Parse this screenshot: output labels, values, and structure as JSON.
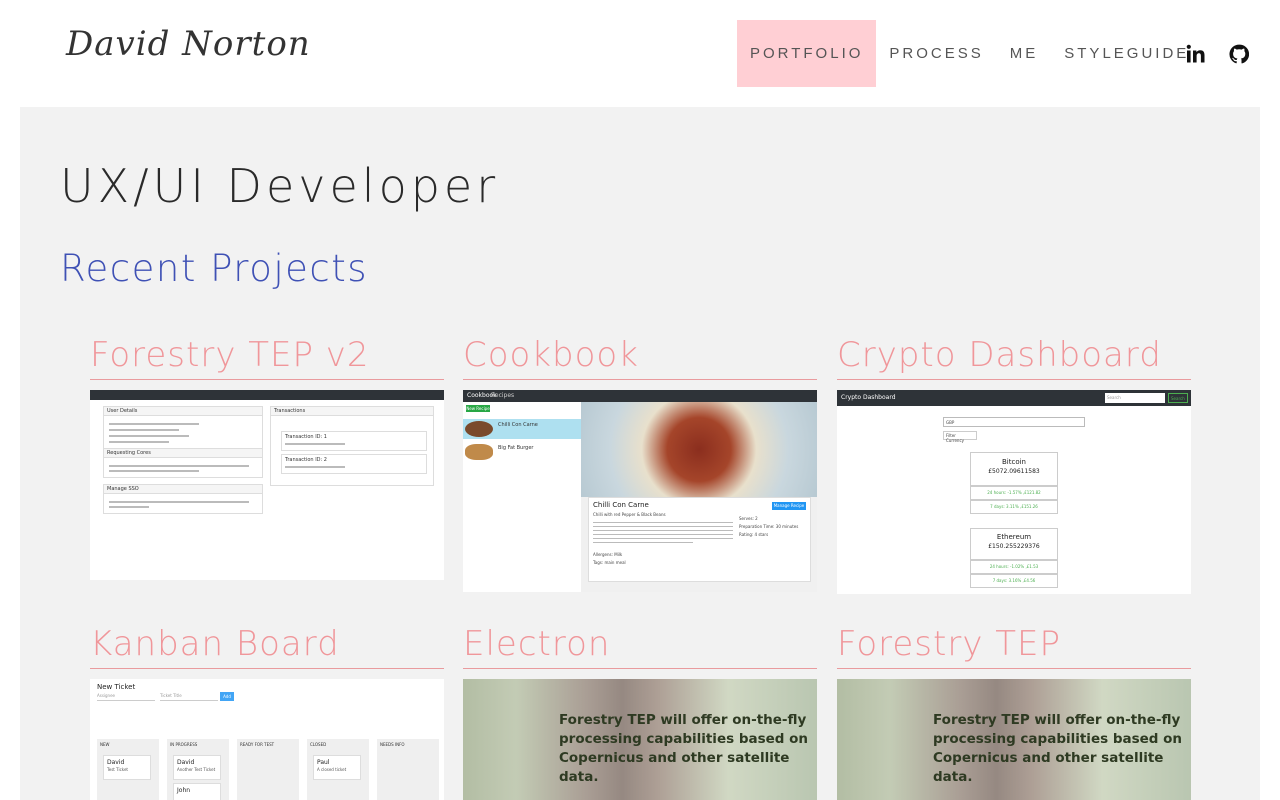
{
  "header": {
    "logo_text": "David Norton",
    "nav": [
      {
        "label": "PORTFOLIO",
        "active": true
      },
      {
        "label": "PROCESS",
        "active": false
      },
      {
        "label": "ME",
        "active": false
      },
      {
        "label": "STYLEGUIDE",
        "active": false
      }
    ],
    "icons": [
      "linkedin-icon",
      "github-icon"
    ]
  },
  "main": {
    "role_title": "UX/UI Developer",
    "section_title": "Recent Projects",
    "projects": [
      {
        "title": "Forestry TEP v2"
      },
      {
        "title": "Cookbook"
      },
      {
        "title": "Crypto Dashboard"
      },
      {
        "title": "Kanban Board"
      },
      {
        "title": "Electron"
      },
      {
        "title": "Forestry TEP"
      }
    ]
  },
  "shots": {
    "forestry_v2": {
      "panels": [
        "User Details",
        "Transactions",
        "Requesting Cores",
        "Manage SSO"
      ],
      "transactions": [
        "Transaction ID: 1",
        "Transaction ID: 2"
      ]
    },
    "cookbook": {
      "app": "Cookbook",
      "nav": "Recipes",
      "new_recipe_button": "New Recipe",
      "list": [
        "Chilli Con Carne",
        "Big Fat Burger"
      ],
      "recipe_title": "Chilli Con Carne",
      "manage_button": "Manage Recipe",
      "recipe_subtitle": "Chilli with red Pepper & Black Beans",
      "allergens": "Allergens: Milk",
      "tags": "Tags: main meal",
      "serves": "Serves: 2",
      "prep": "Preparation Time: 30 minutes",
      "rating": "Rating: 4 stars"
    },
    "crypto": {
      "app": "Crypto Dashboard",
      "search_placeholder": "Search",
      "search_button": "Search",
      "currency": "GBP",
      "filter": "Filter Currency",
      "coins": [
        {
          "name": "Bitcoin",
          "price": "£5072.09611583",
          "h24": "24 hours: -1.57% ,£121.82",
          "d7": "7 days: 3.11% ,£151.26"
        },
        {
          "name": "Ethereum",
          "price": "£150.255229376",
          "h24": "24 hours: -1.02% ,£1.53",
          "d7": "7 days: 3.16% ,£4.56"
        }
      ],
      "colors": {
        "positive": "#4caf50",
        "negative": "#e53935"
      }
    },
    "kanban": {
      "new_ticket": "New Ticket",
      "assignee_placeholder": "Assignee",
      "title_placeholder": "Ticket Title",
      "add_button": "Add",
      "columns": [
        "NEW",
        "IN PROGRESS",
        "READY FOR TEST",
        "CLOSED",
        "NEEDS INFO"
      ],
      "cards": [
        {
          "col": 0,
          "name": "David",
          "text": "Test Ticket"
        },
        {
          "col": 1,
          "name": "David",
          "text": "Another Test Ticket"
        },
        {
          "col": 1,
          "name": "John",
          "text": ""
        },
        {
          "col": 3,
          "name": "Paul",
          "text": "A closed ticket"
        }
      ]
    },
    "electron_text": "Forestry TEP will offer on-the-fly processing capabilities based on Copernicus and other satellite data.",
    "forestry_text": "Forestry TEP will offer on-the-fly processing capabilities based on Copernicus and other satellite data."
  },
  "colors": {
    "accent_blue": "#3f51b5",
    "project_title": "#f0969a",
    "nav_active_bg": "#ffcfd4",
    "panel_bg": "#f2f2f2"
  }
}
